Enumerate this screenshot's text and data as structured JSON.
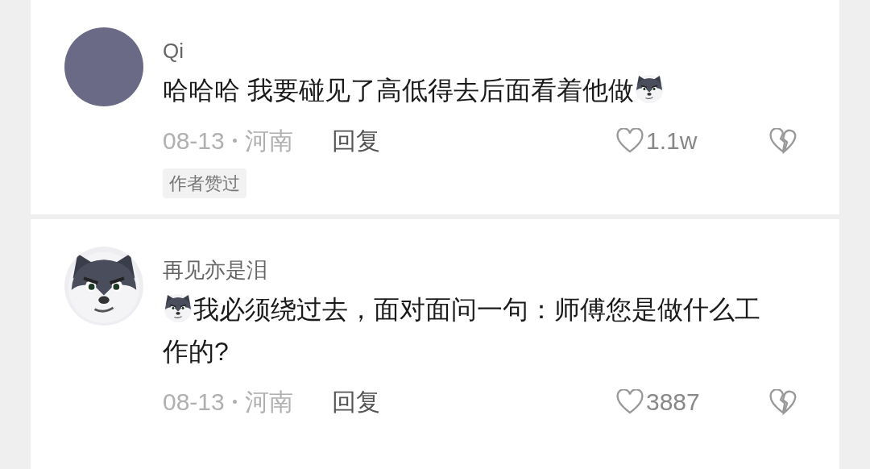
{
  "comments": [
    {
      "username": "Qi",
      "avatar": {
        "kind": "photo"
      },
      "parts": [
        {
          "kind": "text",
          "text": "哈哈哈 我要碰见了高低得去后面看着他做"
        },
        {
          "kind": "emoji"
        }
      ],
      "date": "08-13",
      "location": "河南",
      "reply": "回复",
      "likes": "1.1w",
      "badge": "作者赞过"
    },
    {
      "username": "再见亦是泪",
      "avatar": {
        "kind": "dog"
      },
      "parts": [
        {
          "kind": "emoji"
        },
        {
          "kind": "text",
          "text": "我必须绕过去，面对面问一句：师傅您是做什么工作的?"
        }
      ],
      "date": "08-13",
      "location": "河南",
      "reply": "回复",
      "likes": "3887"
    }
  ]
}
